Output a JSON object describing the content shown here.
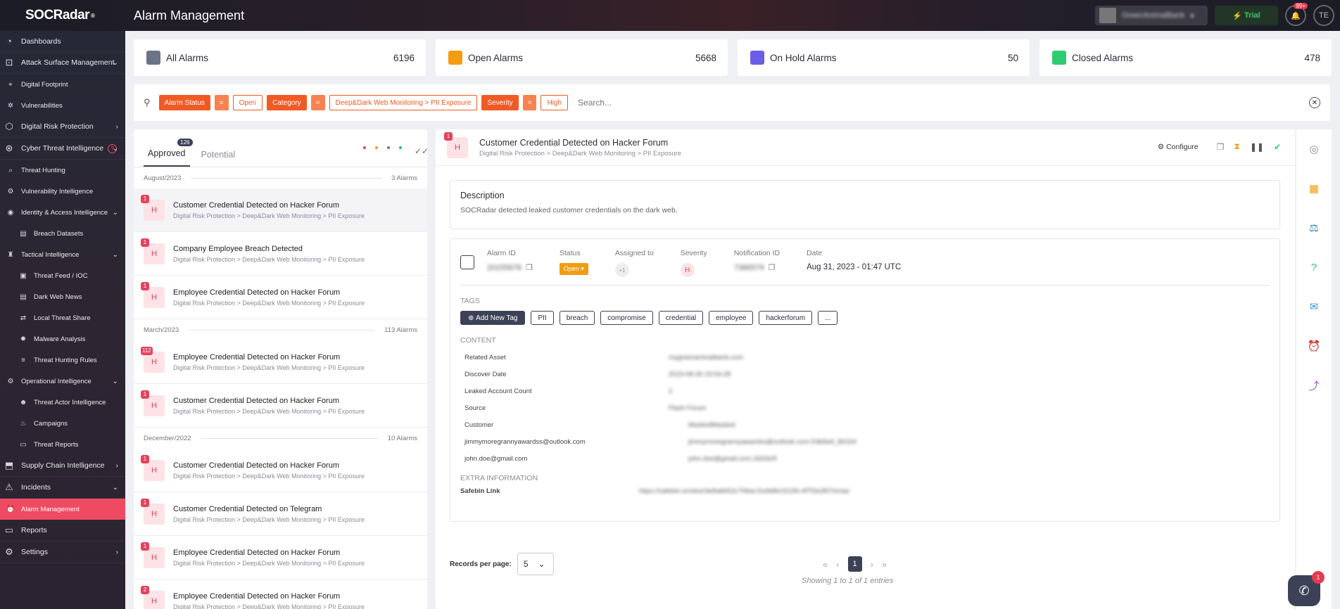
{
  "header": {
    "logo": "SOCRadar",
    "logo_reg": "®",
    "title": "Alarm Management",
    "org_name": "GreenAnimalBank",
    "trial_label": "Trial",
    "notif_badge": "99+",
    "user_initials": "TE"
  },
  "sidebar": {
    "items": [
      {
        "label": "Dashboards",
        "icon": "dashboard-icon",
        "level": 0
      },
      {
        "label": "Attack Surface Management",
        "icon": "attack-surface-icon",
        "level": 0,
        "chev": "down"
      },
      {
        "label": "Digital Footprint",
        "icon": "footprint-icon",
        "level": 1
      },
      {
        "label": "Vulnerabilities",
        "icon": "bug-icon",
        "level": 1
      },
      {
        "label": "Digital Risk Protection",
        "icon": "risk-icon",
        "level": 0,
        "chev": "right"
      },
      {
        "label": "Cyber Threat Intelligence",
        "icon": "cti-icon",
        "level": 0,
        "chev": "down",
        "help": true
      },
      {
        "label": "Threat Hunting",
        "icon": "search-icon",
        "level": 1
      },
      {
        "label": "Vulnerability Intelligence",
        "icon": "vuln-icon",
        "level": 1
      },
      {
        "label": "Identity & Access Intelligence",
        "icon": "fingerprint-icon",
        "level": 1,
        "chev": "down"
      },
      {
        "label": "Breach Datasets",
        "icon": "database-icon",
        "level": 2
      },
      {
        "label": "Tactical Intelligence",
        "icon": "tactical-icon",
        "level": 1,
        "chev": "down"
      },
      {
        "label": "Threat Feed / IOC",
        "icon": "feed-icon",
        "level": 2
      },
      {
        "label": "Dark Web News",
        "icon": "news-icon",
        "level": 2
      },
      {
        "label": "Local Threat Share",
        "icon": "share-icon",
        "level": 2
      },
      {
        "label": "Malware Analysis",
        "icon": "malware-icon",
        "level": 2
      },
      {
        "label": "Threat Hunting Rules",
        "icon": "rules-icon",
        "level": 2
      },
      {
        "label": "Operational Intelligence",
        "icon": "ops-icon",
        "level": 1,
        "chev": "down"
      },
      {
        "label": "Threat Actor Intelligence",
        "icon": "actor-icon",
        "level": 2
      },
      {
        "label": "Campaigns",
        "icon": "campaign-icon",
        "level": 2
      },
      {
        "label": "Threat Reports",
        "icon": "report-icon",
        "level": 2
      },
      {
        "label": "Supply Chain Intelligence",
        "icon": "supply-chain-icon",
        "level": 0,
        "chev": "right"
      },
      {
        "label": "Incidents",
        "icon": "incident-icon",
        "level": 0,
        "chev": "down"
      },
      {
        "label": "Alarm Management",
        "icon": "alarm-icon",
        "level": 1,
        "active": true
      },
      {
        "label": "Reports",
        "icon": "reports-icon",
        "level": 0
      },
      {
        "label": "Settings",
        "icon": "settings-icon",
        "level": 0,
        "chev": "right"
      }
    ]
  },
  "stats": [
    {
      "label": "All Alarms",
      "count": "6196",
      "color": "#6b7385"
    },
    {
      "label": "Open Alarms",
      "count": "5668",
      "color": "#f39c12"
    },
    {
      "label": "On Hold Alarms",
      "count": "50",
      "color": "#6c5ce7"
    },
    {
      "label": "Closed Alarms",
      "count": "478",
      "color": "#2ecc71"
    }
  ],
  "filters": {
    "chips": [
      {
        "type": "key",
        "text": "Alarm Status"
      },
      {
        "type": "op",
        "text": "="
      },
      {
        "type": "val",
        "text": "Open"
      },
      {
        "type": "key",
        "text": "Category"
      },
      {
        "type": "op",
        "text": "="
      },
      {
        "type": "val",
        "text": "Deep&Dark Web Monitoring > PII Exposure"
      },
      {
        "type": "key",
        "text": "Severity"
      },
      {
        "type": "op",
        "text": "="
      },
      {
        "type": "val",
        "text": "High"
      }
    ],
    "search_placeholder": "Search..."
  },
  "list": {
    "tabs": [
      {
        "label": "Approved",
        "badge": "126"
      },
      {
        "label": "Potential",
        "badge": ""
      }
    ],
    "dot_colors": [
      "#e5425c",
      "#f39c12",
      "#9b59b6",
      "#1abc9c"
    ],
    "groups": [
      {
        "title": "August/2023",
        "count": "3 Alarms",
        "items": [
          {
            "n": "1",
            "sev": "H",
            "title": "Customer Credential Detected on Hacker Forum",
            "sub": "Digital Risk Protection > Deep&Dark Web Monitoring > PII Exposure",
            "selected": true
          },
          {
            "n": "1",
            "sev": "H",
            "title": "Company Employee Breach Detected",
            "sub": "Digital Risk Protection > Deep&Dark Web Monitoring > PII Exposure"
          },
          {
            "n": "1",
            "sev": "H",
            "title": "Employee Credential Detected on Hacker Forum",
            "sub": "Digital Risk Protection > Deep&Dark Web Monitoring > PII Exposure"
          }
        ]
      },
      {
        "title": "March/2023",
        "count": "113 Alarms",
        "items": [
          {
            "n": "112",
            "sev": "H",
            "title": "Employee Credential Detected on Hacker Forum",
            "sub": "Digital Risk Protection > Deep&Dark Web Monitoring > PII Exposure"
          },
          {
            "n": "1",
            "sev": "H",
            "title": "Customer Credential Detected on Hacker Forum",
            "sub": "Digital Risk Protection > Deep&Dark Web Monitoring > PII Exposure"
          }
        ]
      },
      {
        "title": "December/2022",
        "count": "10 Alarms",
        "items": [
          {
            "n": "1",
            "sev": "H",
            "title": "Customer Credential Detected on Hacker Forum",
            "sub": "Digital Risk Protection > Deep&Dark Web Monitoring > PII Exposure"
          },
          {
            "n": "1",
            "sev": "H",
            "title": "Customer Credential Detected on Telegram",
            "sub": "Digital Risk Protection > Deep&Dark Web Monitoring > PII Exposure"
          },
          {
            "n": "1",
            "sev": "H",
            "title": "Employee Credential Detected on Hacker Forum",
            "sub": "Digital Risk Protection > Deep&Dark Web Monitoring > PII Exposure"
          },
          {
            "n": "2",
            "sev": "H",
            "title": "Employee Credential Detected on Hacker Forum",
            "sub": "Digital Risk Protection > Deep&Dark Web Monitoring > PII Exposure"
          }
        ]
      }
    ]
  },
  "detail": {
    "n": "1",
    "sev": "H",
    "title": "Customer Credential Detected on Hacker Forum",
    "sub": "Digital Risk Protection > Deep&Dark Web Monitoring > PII Exposure",
    "configure_label": "Configure",
    "desc_heading": "Description",
    "desc_text": "SOCRadar detected leaked customer credentials on the dark web.",
    "meta": {
      "alarm_id_label": "Alarm ID",
      "alarm_id": "20155676",
      "status_label": "Status",
      "status": "Open",
      "assigned_label": "Assigned to",
      "assigned": "+1",
      "severity_label": "Severity",
      "severity": "H",
      "notif_label": "Notification ID",
      "notif": "7366579",
      "date_label": "Date",
      "date": "Aug 31, 2023 - 01:47 UTC"
    },
    "tags_heading": "TAGS",
    "add_tag_label": "Add New Tag",
    "tags": [
      "PII",
      "breach",
      "compromise",
      "credential",
      "employee",
      "hackerforum",
      "..."
    ],
    "content_heading": "CONTENT",
    "content": [
      {
        "k": "Related Asset",
        "v": "mygreenanimalbank.com"
      },
      {
        "k": "Discover Date",
        "v": "2023-08-30 23:54:28"
      },
      {
        "k": "Leaked Account Count",
        "v": "2"
      },
      {
        "k": "Source",
        "v": "Flash Forum"
      },
      {
        "k": "Customer",
        "v": "MaskedMasked"
      },
      {
        "k": "jimmymoregrannyawardss@outlook.com",
        "v": "jimmymoregrannyawardss@outlook.com:S4b5d4_$4154"
      },
      {
        "k": "john.doe@gmail.com",
        "v": "john.doe@gmail.com:Jd33s0f"
      }
    ],
    "extra_heading": "EXTRA INFORMATION",
    "extra_key": "Safebin Link",
    "extra_val": "https://safebin.io/view/3e8a6b52c7f4ba-f1e9d8c02190-4f7f1b2f07e/raw"
  },
  "pagination": {
    "rpp_label": "Records per page:",
    "rpp_value": "5",
    "current_page": "1",
    "showing": "Showing 1 to 1 of 1 entries"
  },
  "chat_badge": "1"
}
